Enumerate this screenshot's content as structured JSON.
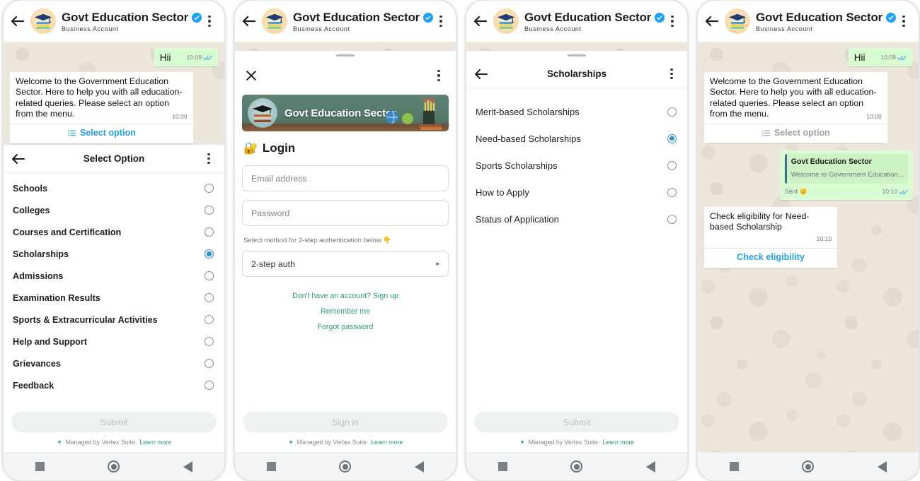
{
  "header": {
    "title": "Govt Education Sector",
    "subtitle": "Business Account",
    "verified_icon": "verified-badge-icon",
    "back_icon": "back-arrow-icon",
    "menu_icon": "kebab-menu-icon",
    "avatar_icon": "graduation-cap-books-avatar"
  },
  "colors": {
    "chat_bg": "#ece6dd",
    "outgoing_bubble": "#d9fdd3",
    "incoming_bubble": "#ffffff",
    "link_blue": "#22a2e0",
    "verified_blue": "#1da1f2",
    "radio_selected": "#2d8fd0",
    "brand_green": "#2f9e6e",
    "banner_green": "#567a6c",
    "tick_blue": "#4fa9e0"
  },
  "panel1": {
    "messages": [
      {
        "direction": "out",
        "text": "Hii",
        "time": "10:09",
        "ticks": "double-check-read"
      },
      {
        "direction": "in",
        "text": "Welcome to the Government Education Sector. Here to help you with all education-related queries. Please select an option from the menu.",
        "time": "10:09",
        "action_label": "Select option",
        "action_icon": "list-menu-icon",
        "action_enabled": true
      }
    ],
    "sheet": {
      "title": "Select Option",
      "back_icon": "back-arrow-icon",
      "menu_icon": "kebab-menu-icon",
      "options": [
        {
          "label": "Schools",
          "selected": false
        },
        {
          "label": "Colleges",
          "selected": false
        },
        {
          "label": "Courses and Certification",
          "selected": false
        },
        {
          "label": "Scholarships",
          "selected": true
        },
        {
          "label": "Admissions",
          "selected": false
        },
        {
          "label": "Examination Results",
          "selected": false
        },
        {
          "label": "Sports & Extracurricular Activities",
          "selected": false
        },
        {
          "label": "Help and Support",
          "selected": false
        },
        {
          "label": "Grievances",
          "selected": false
        },
        {
          "label": "Feedback",
          "selected": false
        }
      ],
      "submit_label": "Submit"
    },
    "footer": {
      "flag_icon": "vertex-flag-icon",
      "managed_text": "Managed by Vertex Suite.",
      "link_label": "Learn more"
    }
  },
  "panel2": {
    "close_icon": "close-x-icon",
    "menu_icon": "kebab-menu-icon",
    "grabber_icon": "sheet-grabber-icon",
    "banner": {
      "title": "Govt Education Sector",
      "logo_icon": "graduation-cap-books-logo",
      "props_icon": "globe-apple-pencils-books-icon"
    },
    "form": {
      "title": "Login",
      "title_icon": "lock-emoji",
      "email_placeholder": "Email address",
      "password_placeholder": "Password",
      "two_step_hint": "Select method for 2-step authentication below 👇",
      "two_step_value": "2-step auth",
      "caret_icon": "chevron-right-icon",
      "signup_link": "Don't have an account? Sign up",
      "remember_link": "Remember me",
      "forgot_link": "Forgot password",
      "submit_label": "Sign in"
    },
    "footer": {
      "flag_icon": "vertex-flag-icon",
      "managed_text": "Managed by Vertex Suite.",
      "link_label": "Learn more"
    }
  },
  "panel3": {
    "grabber_icon": "sheet-grabber-icon",
    "sheet": {
      "title": "Scholarships",
      "back_icon": "back-arrow-icon",
      "menu_icon": "kebab-menu-icon",
      "options": [
        {
          "label": "Merit-based Scholarships",
          "selected": false
        },
        {
          "label": "Need-based Scholarships",
          "selected": true
        },
        {
          "label": "Sports Scholarships",
          "selected": false
        },
        {
          "label": "How to Apply",
          "selected": false
        },
        {
          "label": "Status of Application",
          "selected": false
        }
      ],
      "submit_label": "Submit"
    },
    "footer": {
      "flag_icon": "vertex-flag-icon",
      "managed_text": "Managed by Vertex Suite.",
      "link_label": "Learn more"
    }
  },
  "panel4": {
    "messages": [
      {
        "direction": "out",
        "text": "Hii",
        "time": "10:09",
        "ticks": "double-check-read"
      },
      {
        "direction": "in",
        "text": "Welcome to the Government Education Sector. Here to help you with all education-related queries. Please select an option from the menu.",
        "time": "10:09",
        "action_label": "Select option",
        "action_icon": "list-menu-icon",
        "action_enabled": false
      },
      {
        "direction": "out",
        "quote_name": "Govt Education Sector",
        "quote_text": "Welcome to Government Education...",
        "sent_label": "Sent",
        "sent_emoji": "🙂",
        "time": "10:10",
        "ticks": "double-check-read"
      },
      {
        "direction": "in",
        "text": "Check eligibility for Need-based Scholarship",
        "time": "10:10",
        "action_label": "Check eligibility",
        "action_enabled": true
      }
    ]
  },
  "navbar": {
    "recents_icon": "square-recents-icon",
    "home_icon": "circle-home-icon",
    "back_icon": "triangle-back-icon"
  }
}
